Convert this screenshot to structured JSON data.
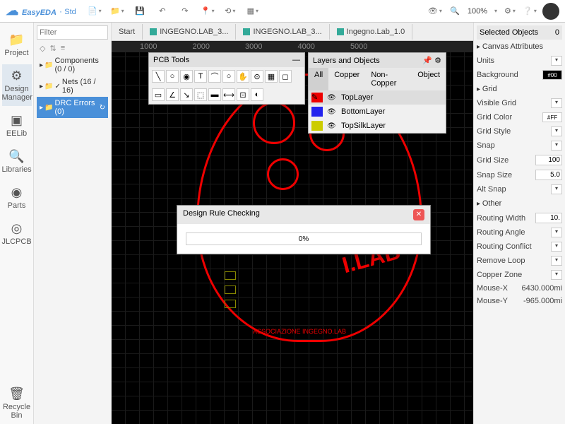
{
  "app": {
    "name": "EasyEDA",
    "edition": "Std",
    "zoom": "100%"
  },
  "tabs": [
    {
      "label": "Start"
    },
    {
      "label": "INGEGNO.LAB_3..."
    },
    {
      "label": "INGEGNO.LAB_3..."
    },
    {
      "label": "Ingegno.Lab_1.0"
    }
  ],
  "leftbar": [
    {
      "label": "Project"
    },
    {
      "label": "Design Manager"
    },
    {
      "label": "EELib"
    },
    {
      "label": "Libraries"
    },
    {
      "label": "Parts"
    },
    {
      "label": "JLCPCB"
    },
    {
      "label": "Recycle Bin"
    }
  ],
  "filter": {
    "placeholder": "Filter"
  },
  "tree": {
    "components": "Components (0 / 0)",
    "nets": "Nets (16 / 16)",
    "drc": "DRC Errors (0)"
  },
  "pcbTools": {
    "title": "PCB Tools"
  },
  "layers": {
    "title": "Layers and Objects",
    "tabs": [
      "All",
      "Copper",
      "Non-Copper",
      "Object"
    ],
    "items": [
      {
        "name": "TopLayer",
        "color": "#e00"
      },
      {
        "name": "BottomLayer",
        "color": "#22e"
      },
      {
        "name": "TopSilkLayer",
        "color": "#cc0"
      }
    ]
  },
  "dialog": {
    "title": "Design Rule Checking",
    "progress": "0%"
  },
  "right": {
    "selected": {
      "label": "Selected Objects",
      "count": "0"
    },
    "canvasAttr": "Canvas Attributes",
    "units": "Units",
    "background": "Background",
    "bgVal": "#00",
    "grid": "Grid",
    "visibleGrid": "Visible Grid",
    "gridColor": "Grid Color",
    "gridColorVal": "#FF",
    "gridStyle": "Grid Style",
    "snap": "Snap",
    "gridSize": "Grid Size",
    "gridSizeVal": "100",
    "snapSize": "Snap Size",
    "snapSizeVal": "5.0",
    "altSnap": "Alt Snap",
    "other": "Other",
    "routingWidth": "Routing Width",
    "routingWidthVal": "10.",
    "routingAngle": "Routing Angle",
    "routingConflict": "Routing Conflict",
    "removeLoop": "Remove Loop",
    "copperZone": "Copper Zone",
    "mouseX": "Mouse-X",
    "mouseXVal": "6430.000mi",
    "mouseY": "Mouse-Y",
    "mouseYVal": "-965.000mi"
  },
  "ruler": [
    "1000",
    "2000",
    "3000",
    "4000",
    "5000"
  ],
  "art": {
    "lab": "I.LAB",
    "assoc": "ASSOCIAZIONE INGEGNO.LAB"
  }
}
